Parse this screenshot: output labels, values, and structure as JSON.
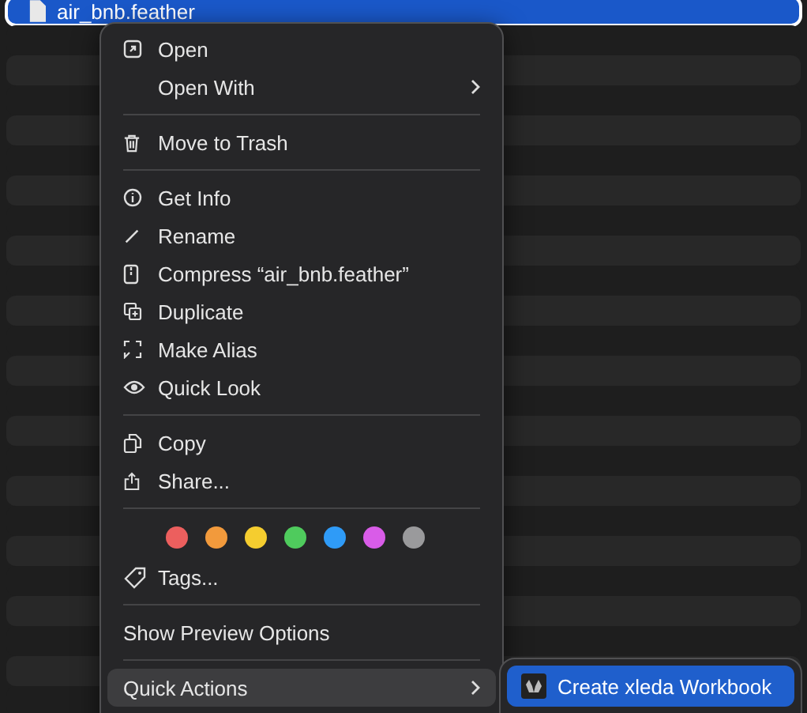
{
  "file_list": {
    "rows": [
      {
        "name": "air_bnb.feather",
        "selected": true
      }
    ]
  },
  "context_menu": {
    "sections": [
      {
        "items": [
          {
            "kind": "action",
            "label": "Open",
            "submenu": false,
            "selected": false
          },
          {
            "kind": "action",
            "label": "Open With",
            "submenu": true,
            "selected": false
          }
        ]
      },
      {
        "items": [
          {
            "kind": "action",
            "label": "Move to Trash",
            "submenu": false,
            "selected": false
          }
        ]
      },
      {
        "items": [
          {
            "kind": "action",
            "label": "Get Info",
            "submenu": false,
            "selected": false
          },
          {
            "kind": "action",
            "label": "Rename",
            "submenu": false,
            "selected": false
          },
          {
            "kind": "action",
            "label": "Compress “air_bnb.feather”",
            "submenu": false,
            "selected": false
          },
          {
            "kind": "action",
            "label": "Duplicate",
            "submenu": false,
            "selected": false
          },
          {
            "kind": "action",
            "label": "Make Alias",
            "submenu": false,
            "selected": false
          },
          {
            "kind": "action",
            "label": "Quick Look",
            "submenu": false,
            "selected": false
          }
        ]
      },
      {
        "items": [
          {
            "kind": "action",
            "label": "Copy",
            "submenu": false,
            "selected": false
          },
          {
            "kind": "action",
            "label": "Share...",
            "submenu": false,
            "selected": false
          }
        ]
      },
      {
        "items": [
          {
            "kind": "colors",
            "colors": [
              {
                "color": "#ec5f5e"
              },
              {
                "color": "#f29a3c"
              },
              {
                "color": "#f5cd2f"
              },
              {
                "color": "#4fcb5d"
              },
              {
                "color": "#2f9bf7"
              },
              {
                "color": "#d95ce8"
              },
              {
                "color": "#9a9a9c"
              }
            ]
          },
          {
            "kind": "action",
            "label": "Tags...",
            "submenu": false,
            "selected": false
          }
        ]
      },
      {
        "items": [
          {
            "kind": "plain",
            "label": "Show Preview Options",
            "submenu": false,
            "selected": false
          }
        ]
      },
      {
        "items": [
          {
            "kind": "plain",
            "label": "Quick Actions",
            "submenu": true,
            "selected": true
          }
        ]
      }
    ]
  },
  "submenu": {
    "items": [
      {
        "label": "Create xleda Workbook",
        "selected": true
      }
    ]
  }
}
